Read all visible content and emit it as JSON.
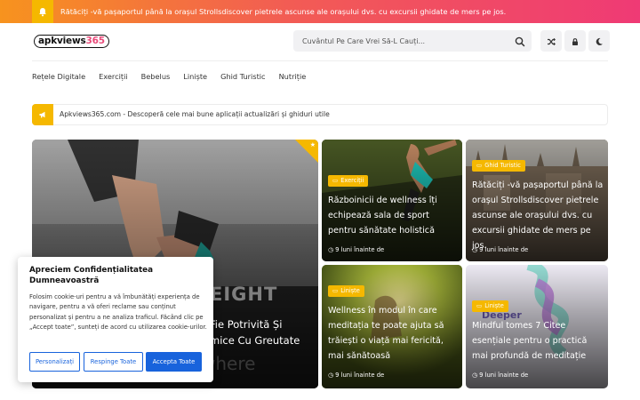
{
  "topbar": {
    "icon": "bell-icon",
    "ticker": "Rătăciți -vă pașaportul până la orașul Strollsdiscover pietrele ascunse ale orașului dvs. cu excursii ghidate de mers pe jos."
  },
  "header": {
    "logo_main": "apkviews",
    "logo_accent": "365",
    "search_placeholder": "Cuvântul Pe Care Vrei Să-L Cauți...",
    "buttons": [
      "search-icon",
      "shuffle-icon",
      "lock-icon",
      "moon-icon"
    ]
  },
  "nav": {
    "items": [
      "Rețele Digitale",
      "Exerciții",
      "Bebelus",
      "Liniște",
      "Ghid Turistic",
      "Nutriție"
    ]
  },
  "notice": {
    "text": "Apkviews365.com - Descoperă cele mai bune aplicații actualizări și ghiduri utile"
  },
  "featured": {
    "title_fragment_1": "Fie Potrivită Și",
    "title_fragment_2": "mice Cu Greutate",
    "image_text_1": "EIGHT",
    "image_text_2": "where"
  },
  "cards": [
    {
      "category": "Exerciții",
      "title": "Războinicii de wellness îți echipează sala de sport pentru sănătate holistică",
      "meta": "9 luni înainte de"
    },
    {
      "category": "Ghid Turistic",
      "title": "Rătăciți -vă pașaportul până la orașul Strollsdiscover pietrele ascunse ale orașului dvs. cu excursii ghidate de mers pe jos.",
      "meta": "9 luni înainte de"
    },
    {
      "category": "Liniște",
      "title": "Wellness în modul în care meditația te poate ajuta să trăiești o viață mai fericită, mai sănătoasă",
      "meta": "9 luni înainte de"
    },
    {
      "category": "Liniște",
      "title": "Mindful tomes 7 Citee esențiale pentru o practică mai profundă de meditație",
      "meta": "9 luni înainte de",
      "image_text": "Deeper"
    }
  ],
  "cookie": {
    "title": "Apreciem Confidențialitatea Dumneavoastră",
    "body": "Folosim cookie-uri pentru a vă îmbunătăți experiența de navigare, pentru a vă oferi reclame sau conținut personalizat și pentru a ne analiza traficul. Făcând clic pe „Accept toate”, sunteți de acord cu utilizarea cookie-urilor.",
    "btn_customize": "Personalizați",
    "btn_reject": "Respinge Toate",
    "btn_accept": "Accepta Toate"
  },
  "colors": {
    "accent": "#f5b800",
    "banner_start": "#f7931e",
    "banner_end": "#ef3a75",
    "primary_button": "#1863dc"
  }
}
